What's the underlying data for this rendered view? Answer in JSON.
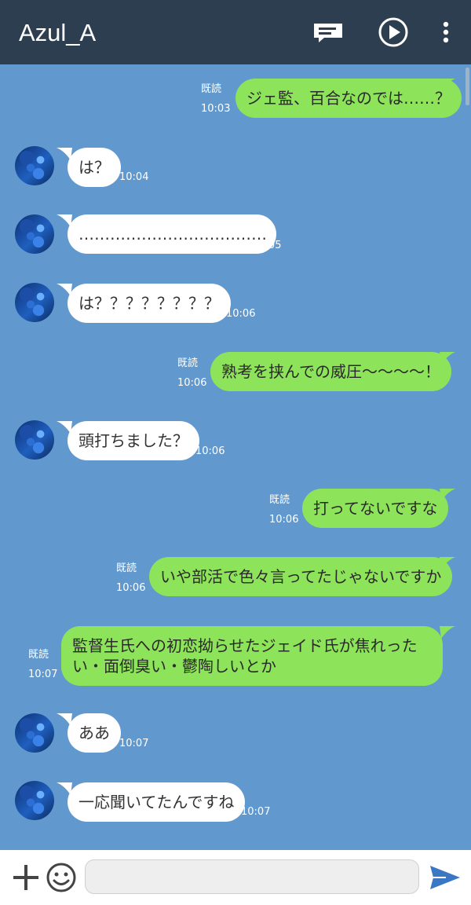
{
  "header": {
    "title": "Azul_A",
    "icons": [
      "note-icon",
      "play-icon",
      "more-vert-icon"
    ],
    "bg_color": "#2c3e50"
  },
  "chat": {
    "bg_color": "#6199cf",
    "incoming_bubble_color": "#ffffff",
    "outgoing_bubble_color": "#8de35a",
    "messages": [
      {
        "dir": "out",
        "text": "ジェ監、百合なのでは……？",
        "time": "10:03",
        "read": "既読"
      },
      {
        "dir": "in",
        "text": "は？",
        "time": "10:04"
      },
      {
        "dir": "in",
        "text": "………………………………",
        "time": "10:05"
      },
      {
        "dir": "in",
        "text": "は？？？？？？？？",
        "time": "10:06"
      },
      {
        "dir": "out",
        "text": "熟考を挟んでの威圧〜〜〜〜！",
        "time": "10:06",
        "read": "既読"
      },
      {
        "dir": "in",
        "text": "頭打ちました？",
        "time": "10:06"
      },
      {
        "dir": "out",
        "text": "打ってないですな",
        "time": "10:06",
        "read": "既読"
      },
      {
        "dir": "out",
        "text": "いや部活で色々言ってたじゃないですか",
        "time": "10:06",
        "read": "既読"
      },
      {
        "dir": "out",
        "text": "監督生氏への初恋拗らせたジェイド氏が焦れったい・面倒臭い・鬱陶しいとか",
        "time": "10:07",
        "read": "既読"
      },
      {
        "dir": "in",
        "text": "ああ",
        "time": "10:07"
      },
      {
        "dir": "in",
        "text": "一応聞いてたんですね",
        "time": "10:07"
      }
    ]
  },
  "input_bar": {
    "value": "",
    "placeholder": "",
    "icons": [
      "plus-icon",
      "emoji-icon",
      "send-icon"
    ],
    "send_color": "#3b78c4"
  }
}
